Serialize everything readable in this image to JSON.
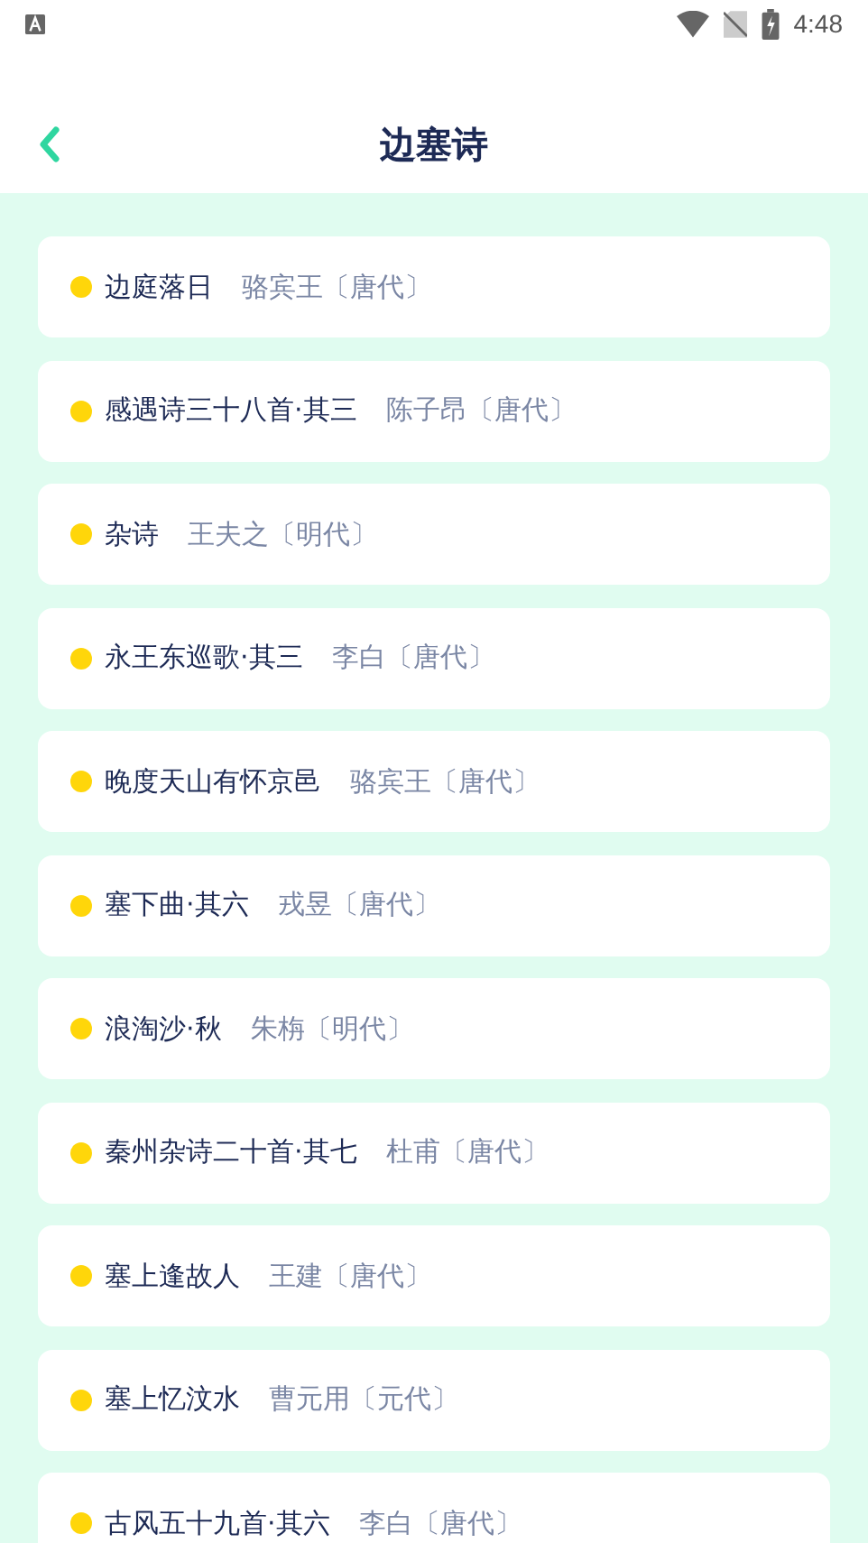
{
  "status_bar": {
    "time": "4:48"
  },
  "header": {
    "title": "边塞诗"
  },
  "poems": [
    {
      "title": "边庭落日",
      "author": "骆宾王〔唐代〕",
      "color": "#ffd60a"
    },
    {
      "title": "感遇诗三十八首·其三",
      "author": "陈子昂〔唐代〕",
      "color": "#ffd60a"
    },
    {
      "title": "杂诗",
      "author": "王夫之〔明代〕",
      "color": "#ffd60a"
    },
    {
      "title": "永王东巡歌·其三",
      "author": "李白〔唐代〕",
      "color": "#ffd60a"
    },
    {
      "title": "晚度天山有怀京邑",
      "author": "骆宾王〔唐代〕",
      "color": "#ffd60a"
    },
    {
      "title": "塞下曲·其六",
      "author": "戎昱〔唐代〕",
      "color": "#ffd60a"
    },
    {
      "title": "浪淘沙·秋",
      "author": "朱栴〔明代〕",
      "color": "#ffd60a"
    },
    {
      "title": "秦州杂诗二十首·其七",
      "author": "杜甫〔唐代〕",
      "color": "#ffd60a"
    },
    {
      "title": "塞上逢故人",
      "author": "王建〔唐代〕",
      "color": "#ffd60a"
    },
    {
      "title": "塞上忆汶水",
      "author": "曹元用〔元代〕",
      "color": "#ffd60a"
    },
    {
      "title": "古风五十九首·其六",
      "author": "李白〔唐代〕",
      "color": "#ffd60a"
    }
  ]
}
